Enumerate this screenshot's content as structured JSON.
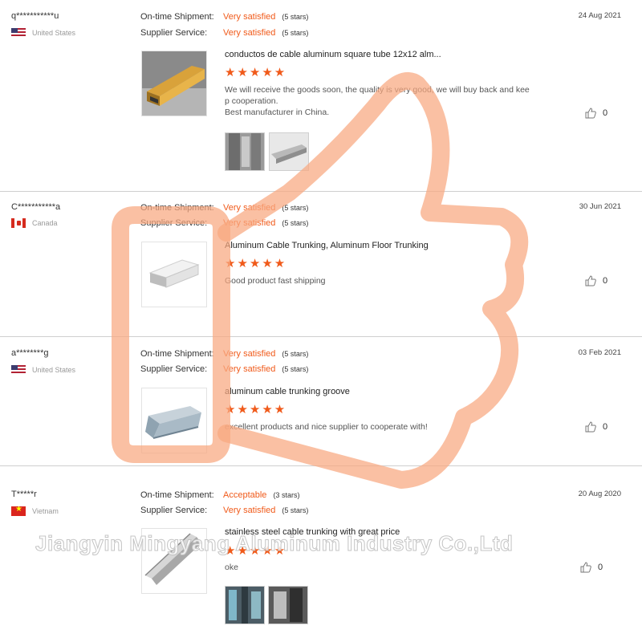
{
  "labels": {
    "on_time": "On-time Shipment:",
    "supplier": "Supplier Service:"
  },
  "reviews": [
    {
      "user": "q***********u",
      "country": "United States",
      "date": "24 Aug 2021",
      "on_time_value": "Very satisfied",
      "on_time_stars": "(5 stars)",
      "supplier_value": "Very satisfied",
      "supplier_stars": "(5 stars)",
      "product_title": "conductos de cable aluminum square tube 12x12 alm...",
      "rating_stars": "★★★★★",
      "comment": [
        "We will receive the goods soon, the quality is very good, we will buy back and kee",
        "p cooperation.",
        "Best manufacturer in China."
      ],
      "likes": "0"
    },
    {
      "user": "C***********a",
      "country": "Canada",
      "date": "30 Jun 2021",
      "on_time_value": "Very satisfied",
      "on_time_stars": "(5 stars)",
      "supplier_value": "Very satisfied",
      "supplier_stars": "(5 stars)",
      "product_title": "Aluminum Cable Trunking, Aluminum Floor Trunking",
      "rating_stars": "★★★★★",
      "comment": [
        "Good product fast shipping"
      ],
      "likes": "0"
    },
    {
      "user": "a********g",
      "country": "United States",
      "date": "03 Feb 2021",
      "on_time_value": "Very satisfied",
      "on_time_stars": "(5 stars)",
      "supplier_value": "Very satisfied",
      "supplier_stars": "(5 stars)",
      "product_title": "aluminum cable trunking groove",
      "rating_stars": "★★★★★",
      "comment": [
        "excellent products and nice supplier to cooperate with!"
      ],
      "likes": "0"
    },
    {
      "user": "T*****r",
      "country": "Vietnam",
      "date": "20 Aug 2020",
      "on_time_value": "Acceptable",
      "on_time_stars": "(3 stars)",
      "supplier_value": "Very satisfied",
      "supplier_stars": "(5 stars)",
      "product_title": "stainless steel cable trunking with great price",
      "rating_stars": "★★★★★",
      "comment": [
        "oke"
      ],
      "likes": "0"
    }
  ],
  "watermark": "Jiangyin Mingyang Aluminum Industry Co.,Ltd",
  "icons": {
    "like": "thumbs-up-icon",
    "overlay": "thumbs-up-outline-icon"
  },
  "colors": {
    "accent": "#f05a1a",
    "overlay": "#f8a77f"
  }
}
